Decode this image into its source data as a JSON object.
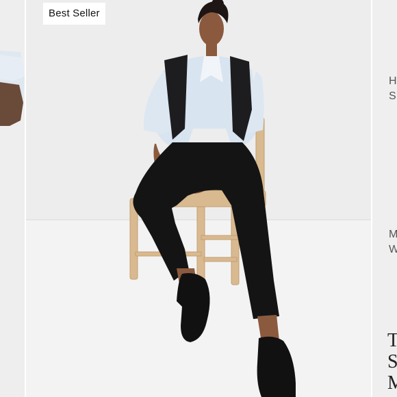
{
  "carousel": {
    "prev_slide": {
      "description_image": "partial model arm and sleeve"
    },
    "main_slide": {
      "badge": "Best Seller",
      "image_subject": "woman seated on wooden chair wearing black pants, light blue shirt, black vest, loafers"
    },
    "next_slide": {
      "text_line_1": "H\nS",
      "text_line_2": "M\nW",
      "text_line_3": "T\nS\nM"
    }
  },
  "colors": {
    "background": "#ffffff",
    "studio_wall": "#ededee",
    "studio_floor": "#f3f3f4",
    "badge_bg": "#ffffff",
    "badge_text": "#111111"
  }
}
